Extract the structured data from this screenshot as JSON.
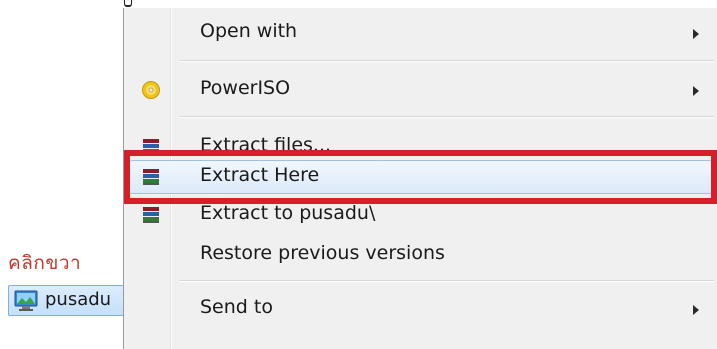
{
  "desktop": {
    "note": "คลิกขวา",
    "file_label": "pusadu"
  },
  "menu": {
    "items": [
      {
        "label": "Open with",
        "icon": "none",
        "submenu": true
      },
      {
        "label": "PowerISO",
        "icon": "poweriso-disc-icon",
        "submenu": true
      },
      {
        "label": "Extract files...",
        "icon": "winrar-books-icon",
        "submenu": false
      },
      {
        "label": "Extract Here",
        "icon": "winrar-books-icon",
        "submenu": false,
        "selected": true
      },
      {
        "label": "Extract to pusadu\\",
        "icon": "winrar-books-icon",
        "submenu": false
      },
      {
        "label": "Restore previous versions",
        "icon": "none",
        "submenu": false
      },
      {
        "label": "Send to",
        "icon": "none",
        "submenu": true
      }
    ]
  },
  "colors": {
    "highlight_box": "#d42029",
    "menu_background": "#f0f0f0",
    "note_text": "#c0392b"
  }
}
